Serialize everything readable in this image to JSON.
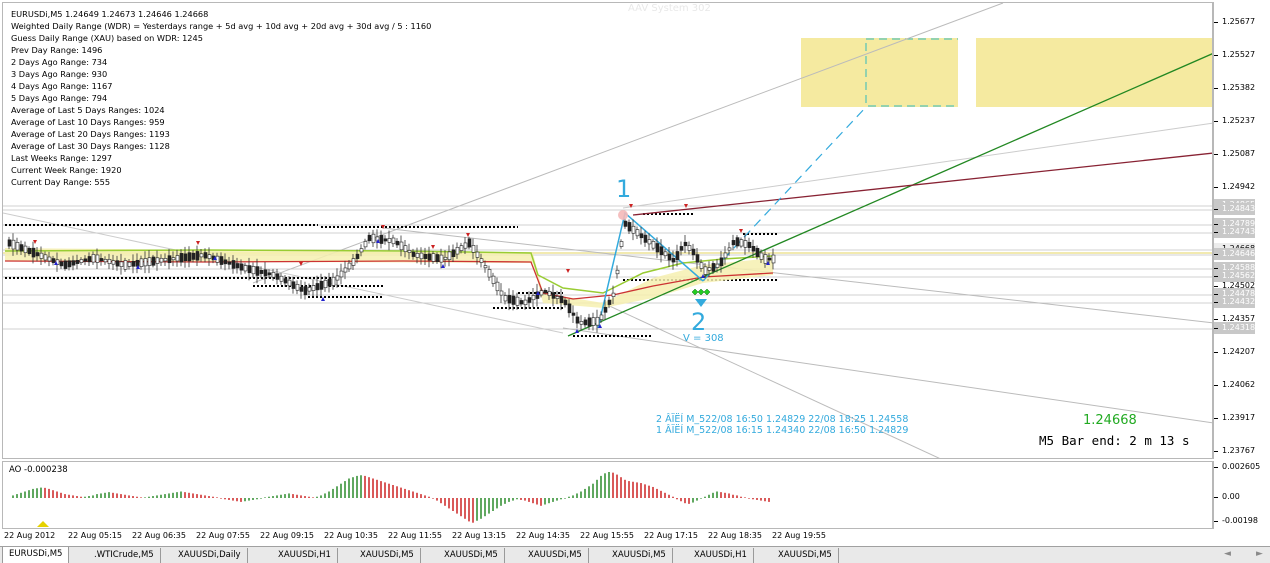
{
  "symbol_header": "EURUSDi,M5  1.24649 1.24673 1.24646 1.24668",
  "top_label": "AAV System 302",
  "info_lines": [
    "Weighted Daily Range (WDR) = Yesterdays range + 5d avg + 10d avg + 20d avg + 30d avg / 5 : 1160",
    "Guess Daily Range (XAU) based on WDR: 1245",
    "Prev Day Range: 1496",
    "2 Days Ago Range: 734",
    "3 Days Ago Range: 930",
    "4 Days Ago Range: 1167",
    "5 Days Ago Range: 794",
    "Average of Last 5 Days Ranges: 1024",
    "Average of Last 10 Days Ranges: 959",
    "Average of Last 20 Days Ranges: 1193",
    "Average of Last 30 Days Ranges: 1128",
    "Last Weeks Range: 1297",
    "Current Week Range: 1920",
    "Current Day Range: 555"
  ],
  "wave": {
    "label_1": "1",
    "label_2": "2",
    "volume": "V = 308",
    "info_line_1": "2 ÂÏËÍ M_522/08 16:50 1.24829 22/08 18:25 1.24558",
    "info_line_2": "1 ÂÏËÍ M_522/08 16:15 1.24340 22/08 16:50 1.24829"
  },
  "current_price": "1.24668",
  "bar_end": "M5 Bar end: 2 m 13 s",
  "price_ticks": [
    {
      "label": "1.25677",
      "style": "plain"
    },
    {
      "label": "1.25527",
      "style": "plain"
    },
    {
      "label": "1.25382",
      "style": "plain"
    },
    {
      "label": "1.25237",
      "style": "plain"
    },
    {
      "label": "1.25087",
      "style": "plain"
    },
    {
      "label": "1.24942",
      "style": "plain"
    },
    {
      "label": "1.24865",
      "style": "gray"
    },
    {
      "label": "1.24843",
      "style": "gray"
    },
    {
      "label": "1.24789",
      "style": "gray"
    },
    {
      "label": "1.24743",
      "style": "gray"
    },
    {
      "label": "1.24668",
      "style": "cur"
    },
    {
      "label": "1.24646",
      "style": "gray"
    },
    {
      "label": "1.24588",
      "style": "gray"
    },
    {
      "label": "1.24562",
      "style": "gray"
    },
    {
      "label": "1.24502",
      "style": "plain"
    },
    {
      "label": "1.24478",
      "style": "gray"
    },
    {
      "label": "1.24432",
      "style": "gray"
    },
    {
      "label": "1.24357",
      "style": "plain"
    },
    {
      "label": "1.24318",
      "style": "gray"
    },
    {
      "label": "1.24207",
      "style": "plain"
    },
    {
      "label": "1.24062",
      "style": "plain"
    },
    {
      "label": "1.23917",
      "style": "plain"
    },
    {
      "label": "1.23767",
      "style": "plain"
    }
  ],
  "ao": {
    "title": "AO -0.000238",
    "ticks": [
      "0.002605",
      "0.00",
      "-0.00198"
    ],
    "values": [
      0.2,
      0.3,
      0.4,
      0.5,
      0.6,
      0.7,
      0.75,
      0.8,
      0.78,
      0.7,
      0.6,
      0.5,
      0.4,
      0.3,
      0.25,
      0.2,
      0.15,
      0.1,
      0.1,
      0.15,
      0.2,
      0.3,
      0.35,
      0.4,
      0.45,
      0.4,
      0.35,
      0.3,
      0.25,
      0.2,
      0.15,
      0.1,
      0.05,
      0.05,
      0.1,
      0.15,
      0.2,
      0.25,
      0.3,
      0.35,
      0.4,
      0.45,
      0.5,
      0.45,
      0.4,
      0.35,
      0.3,
      0.25,
      0.2,
      0.15,
      0.1,
      0.05,
      -0.05,
      -0.1,
      -0.15,
      -0.2,
      -0.25,
      -0.3,
      -0.25,
      -0.2,
      -0.15,
      -0.1,
      -0.05,
      0.05,
      0.1,
      0.15,
      0.2,
      0.25,
      0.3,
      0.35,
      0.3,
      0.25,
      0.2,
      0.15,
      0.1,
      0.05,
      0.1,
      0.2,
      0.35,
      0.5,
      0.7,
      0.9,
      1.1,
      1.3,
      1.5,
      1.6,
      1.7,
      1.75,
      1.7,
      1.6,
      1.5,
      1.4,
      1.3,
      1.2,
      1.1,
      1.0,
      0.9,
      0.8,
      0.7,
      0.6,
      0.5,
      0.4,
      0.3,
      0.2,
      0.1,
      -0.05,
      -0.2,
      -0.4,
      -0.6,
      -0.8,
      -1.0,
      -1.2,
      -1.4,
      -1.6,
      -1.8,
      -1.9,
      -1.75,
      -1.6,
      -1.4,
      -1.2,
      -1.0,
      -0.8,
      -0.6,
      -0.45,
      -0.3,
      -0.2,
      -0.1,
      -0.15,
      -0.2,
      -0.3,
      -0.4,
      -0.5,
      -0.6,
      -0.5,
      -0.4,
      -0.3,
      -0.2,
      -0.1,
      -0.05,
      0.1,
      0.2,
      0.35,
      0.5,
      0.7,
      0.9,
      1.1,
      1.4,
      1.7,
      1.9,
      2.0,
      1.95,
      1.8,
      1.6,
      1.4,
      1.3,
      1.25,
      1.2,
      1.15,
      1.05,
      0.95,
      0.85,
      0.7,
      0.55,
      0.4,
      0.25,
      0.1,
      -0.1,
      -0.25,
      -0.4,
      -0.45,
      -0.35,
      -0.2,
      -0.05,
      0.1,
      0.25,
      0.4,
      0.5,
      0.45,
      0.4,
      0.35,
      0.25,
      0.2,
      0.1,
      0.05,
      -0.05,
      -0.1,
      -0.15,
      -0.2,
      -0.25,
      -0.3
    ]
  },
  "time_labels": [
    "22 Aug 2012",
    "22 Aug 05:15",
    "22 Aug 06:35",
    "22 Aug 07:55",
    "22 Aug 09:15",
    "22 Aug 10:35",
    "22 Aug 11:55",
    "22 Aug 13:15",
    "22 Aug 14:35",
    "22 Aug 15:55",
    "22 Aug 17:15",
    "22 Aug 18:35",
    "22 Aug 19:55"
  ],
  "tabs": [
    "EURUSDi,M5",
    ".WTICrude,M5",
    "XAUUSDi,Daily",
    "XAUUSDi,H1",
    "XAUUSDi,M5",
    "XAUUSDi,M5",
    "XAUUSDi,M5",
    "XAUUSDi,M5",
    "XAUUSDi,H1",
    "XAUUSDi,M5"
  ],
  "tab_nav": {
    "prev": "◄",
    "next": "►"
  },
  "colors": {
    "rect_zone": "#f5eaa0",
    "wave_blue": "#33aadd",
    "trend_green": "#228822",
    "trend_maroon": "#882233",
    "bull": "#2a8a2a",
    "bear": "#cc2222",
    "price_text": "#22aa22"
  }
}
